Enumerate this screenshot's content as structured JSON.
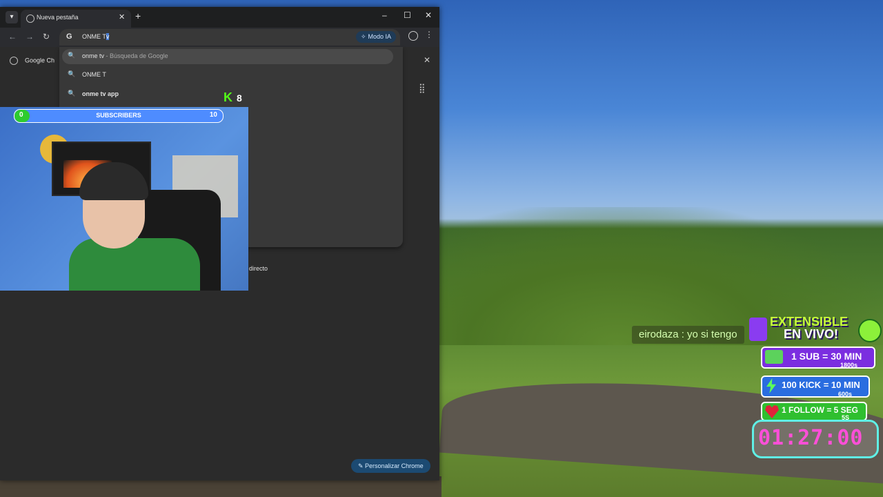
{
  "browser": {
    "tab_title": "Nueva pestaña",
    "omnibox_text": "ONME T",
    "omnibox_selected": "v",
    "modo_ia": "Modo IA",
    "bookmark_label": "Google Ch",
    "customize_label": "Personalizar Chrome",
    "behind_text": "directo"
  },
  "suggestions": [
    {
      "bold": "onme tv",
      "sub": " - Búsqueda de Google"
    },
    {
      "bold": "ONME T",
      "sub": ""
    },
    {
      "bold": "onme tv app",
      "sub": ""
    }
  ],
  "stream": {
    "sub_goal_start": "0",
    "sub_goal_label": "SUBSCRIBERS",
    "sub_goal_end": "10",
    "kick_viewers": "8",
    "chat_message": "eirodaza : yo si tengo",
    "extensible_title": "EXTENSIBLE",
    "extensible_sub": "EN VIVO!",
    "rows": [
      {
        "main": "1 SUB = 30 MIN",
        "sec": "1800s"
      },
      {
        "main": "100 KICK = 10 MIN",
        "sec": "600s"
      },
      {
        "main": "1 FOLLOW = 5 SEG",
        "sec": "5S"
      }
    ],
    "timer": "01:27:00"
  },
  "colors": {
    "accent": "#53fc18",
    "timer": "#ff4fd8",
    "chrome_bg": "#2b2b2b"
  }
}
